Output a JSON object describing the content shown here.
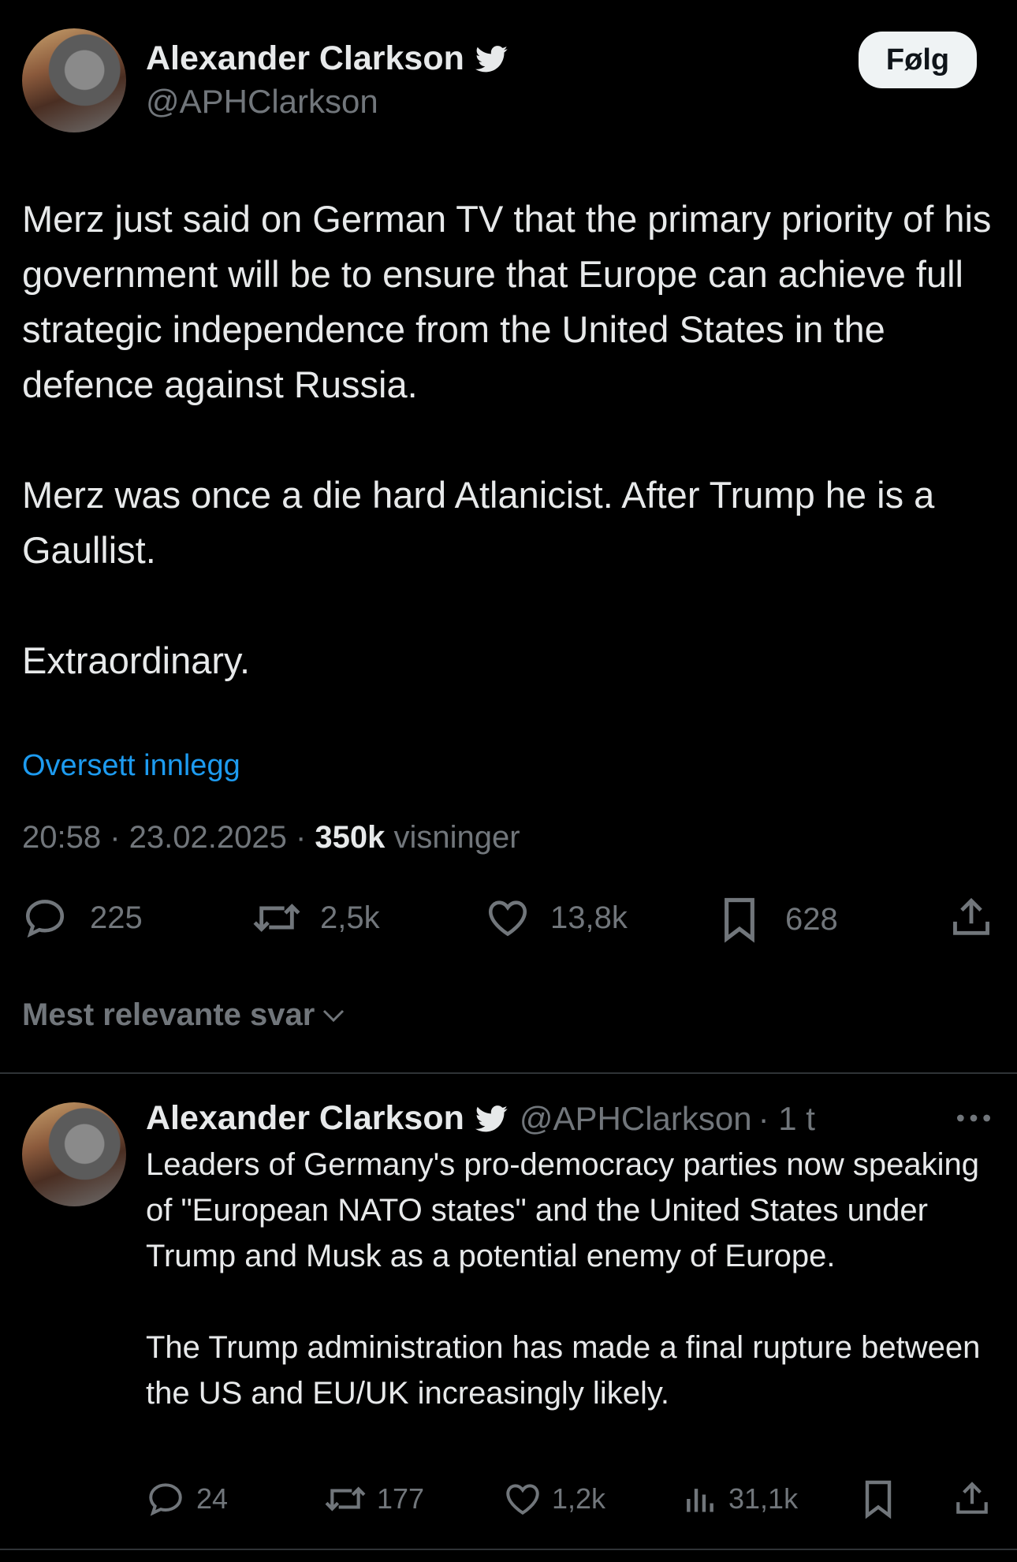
{
  "main_tweet": {
    "author": {
      "name": "Alexander Clarkson",
      "handle": "@APHClarkson",
      "verified_icon": "twitter-bird-icon"
    },
    "follow_label": "Følg",
    "text": "Merz just said on German TV that the primary priority of his government will be to ensure that Europe can achieve full strategic independence from the United States in the defence against Russia.\n\nMerz was once a die hard Atlanicist. After Trump he is a Gaullist.\n\nExtraordinary.",
    "translate_label": "Oversett innlegg",
    "timestamp": "20:58 · 23.02.2025 · ",
    "views_count": "350k",
    "views_label": " visninger",
    "stats": {
      "replies": "225",
      "reposts": "2,5k",
      "likes": "13,8k",
      "bookmarks": "628"
    }
  },
  "sort": {
    "label": "Mest relevante svar"
  },
  "reply": {
    "author": {
      "name": "Alexander Clarkson",
      "handle": "@APHClarkson",
      "time": "· 1 t"
    },
    "text": "Leaders of Germany's pro-democracy parties now speaking of \"European NATO states\" and the United States under Trump and Musk as a potential enemy of Europe.\n\nThe Trump administration has made a final rupture between the US and EU/UK increasingly likely.",
    "stats": {
      "replies": "24",
      "reposts": "177",
      "likes": "1,2k",
      "views": "31,1k"
    }
  },
  "colors": {
    "background": "#000000",
    "text": "#e7e9ea",
    "muted": "#71767b",
    "link": "#1d9bf0",
    "divider": "#2f3336"
  }
}
